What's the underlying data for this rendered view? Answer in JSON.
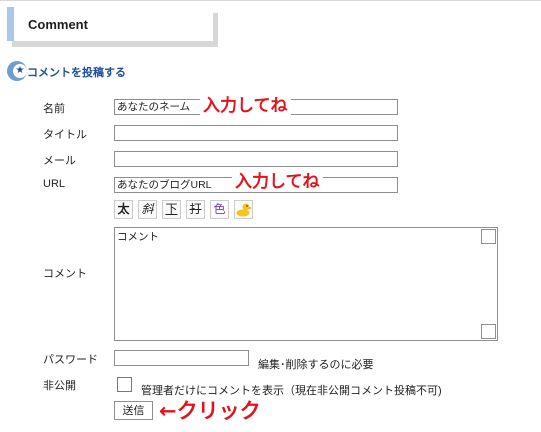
{
  "section": {
    "title": "Comment"
  },
  "form": {
    "heading": "コメントを投稿する",
    "name": {
      "label": "名前",
      "value": "あなたのネーム",
      "hint": "入力してね"
    },
    "title": {
      "label": "タイトル",
      "value": ""
    },
    "mail": {
      "label": "メール",
      "value": ""
    },
    "url": {
      "label": "URL",
      "value": "あなたのブログURL",
      "hint": "入力してね"
    },
    "toolbar": [
      {
        "label": "太",
        "icon": "bold-icon"
      },
      {
        "label": "斜",
        "icon": "italic-icon"
      },
      {
        "label": "下",
        "icon": "underline-icon"
      },
      {
        "label": "打",
        "icon": "strikethrough-icon"
      },
      {
        "label": "色",
        "icon": "color-icon"
      },
      {
        "label": "",
        "icon": "emoticon-duck-icon"
      }
    ],
    "comment": {
      "label": "コメント",
      "value": "コメント"
    },
    "password": {
      "label": "パスワード",
      "value": "",
      "note": "編集･削除するのに必要"
    },
    "private": {
      "label": "非公開",
      "checkbox_label": "管理者だけにコメントを表示（現在非公開コメント投稿不可)"
    },
    "submit": {
      "label": "送信",
      "hint": "←クリック"
    }
  },
  "colors": {
    "accent": "#a9c7e8",
    "heading": "#1b4f9b",
    "hint": "#e0141e"
  }
}
